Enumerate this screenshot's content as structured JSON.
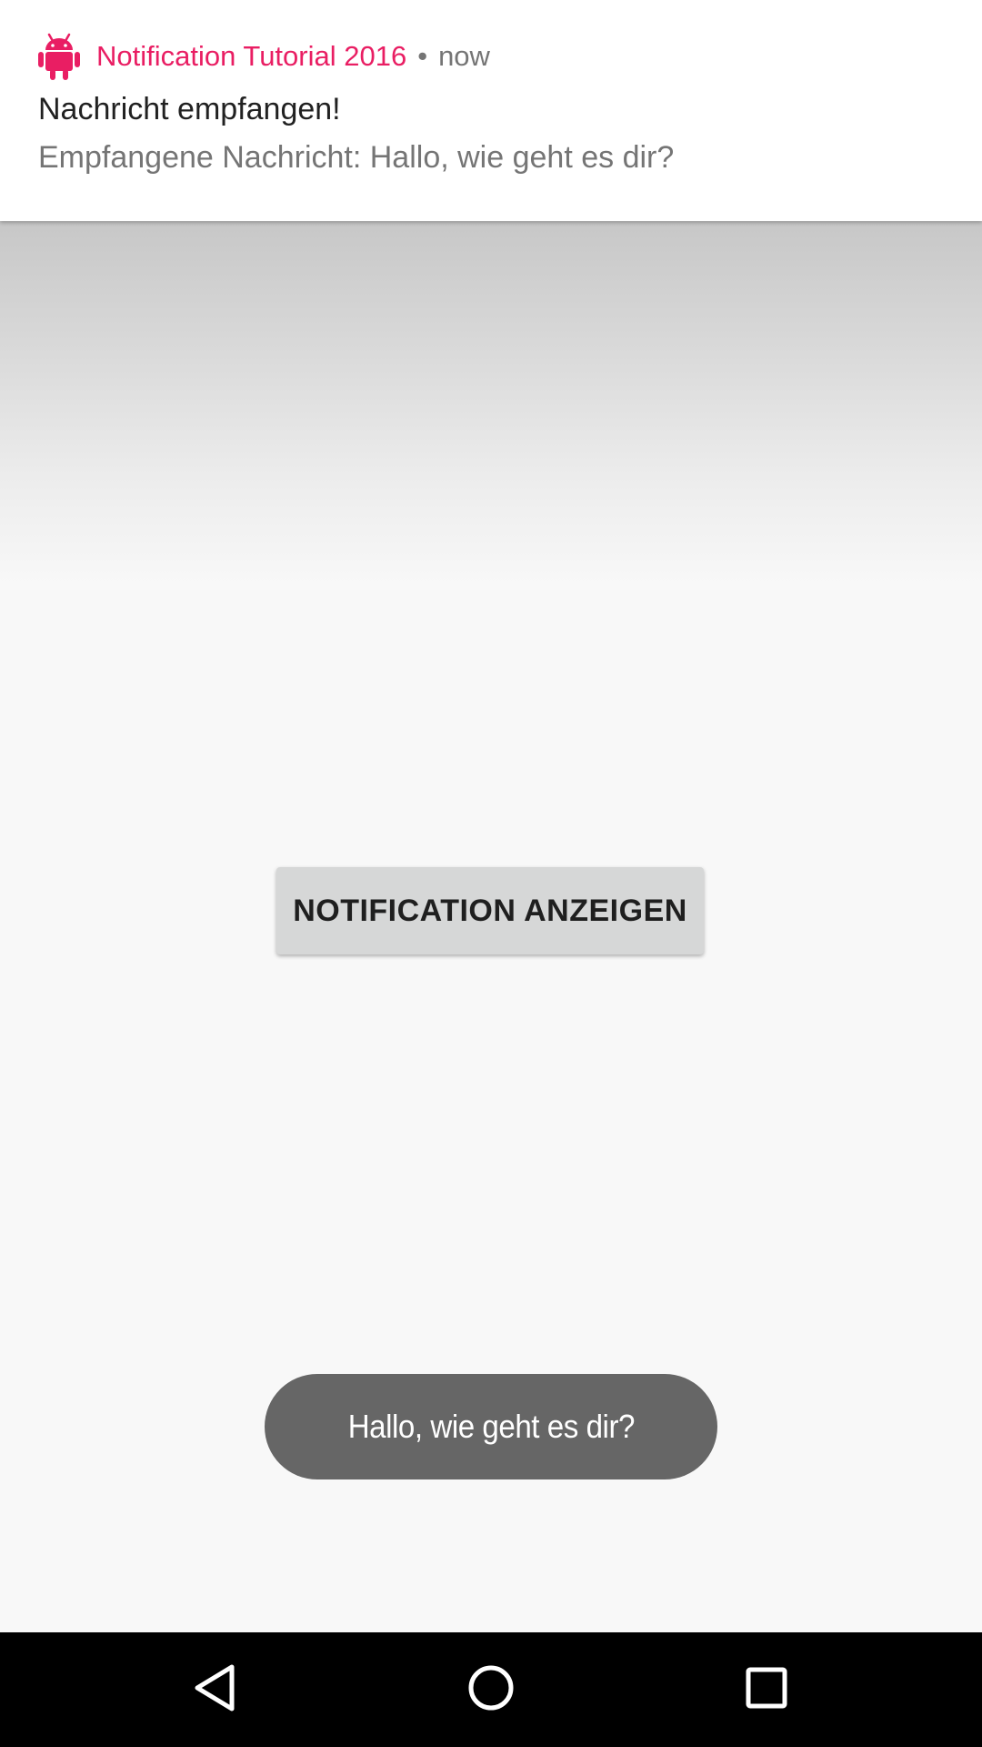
{
  "notification": {
    "app_name": "Notification Tutorial 2016",
    "separator": "•",
    "timestamp": "now",
    "title": "Nachricht empfangen!",
    "text": "Empfangene Nachricht: Hallo, wie geht es dir?",
    "icon": "android-icon",
    "accent_color": "#e91e63"
  },
  "main": {
    "button_label": "NOTIFICATION ANZEIGEN"
  },
  "toast": {
    "message": "Hallo, wie geht es dir?"
  },
  "navbar": {
    "back_icon": "back-triangle-icon",
    "home_icon": "home-circle-icon",
    "recents_icon": "recents-square-icon"
  }
}
